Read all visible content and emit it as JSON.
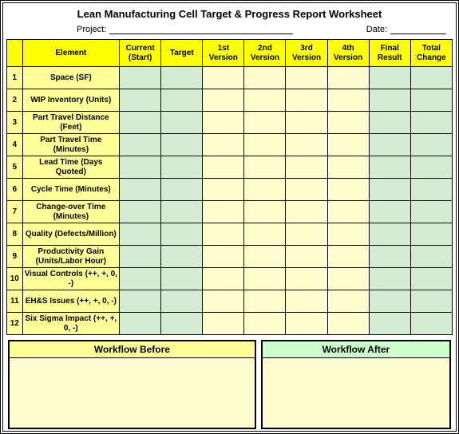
{
  "title": "Lean Manufacturing Cell Target & Progress Report Worksheet",
  "meta": {
    "project_label": "Project:",
    "project_value": "",
    "date_label": "Date:",
    "date_value": ""
  },
  "columns": [
    "Element",
    "Current (Start)",
    "Target",
    "1st Version",
    "2nd Version",
    "3rd Version",
    "4th Version",
    "Final Result",
    "Total Change"
  ],
  "rows": [
    {
      "n": "1",
      "element": "Space (SF)"
    },
    {
      "n": "2",
      "element": "WIP Inventory (Units)"
    },
    {
      "n": "3",
      "element": "Part Travel Distance (Feet)"
    },
    {
      "n": "4",
      "element": "Part Travel Time (Minutes)"
    },
    {
      "n": "5",
      "element": "Lead Time (Days Quoted)"
    },
    {
      "n": "6",
      "element": "Cycle Time (Minutes)"
    },
    {
      "n": "7",
      "element": "Change-over Time (Minutes)"
    },
    {
      "n": "8",
      "element": "Quality (Defects/Million)"
    },
    {
      "n": "9",
      "element": "Productivity Gain (Units/Labor Hour)"
    },
    {
      "n": "10",
      "element": "Visual Controls (++, +, 0, -)"
    },
    {
      "n": "11",
      "element": "EH&S Issues (++, +, 0, -)"
    },
    {
      "n": "12",
      "element": "Six Sigma Impact (++, +, 0, -)"
    }
  ],
  "column_styles": [
    "green",
    "green",
    "cream",
    "cream",
    "cream",
    "cream",
    "green",
    "green"
  ],
  "workflow": {
    "before_label": "Workflow Before",
    "after_label": "Workflow After"
  }
}
